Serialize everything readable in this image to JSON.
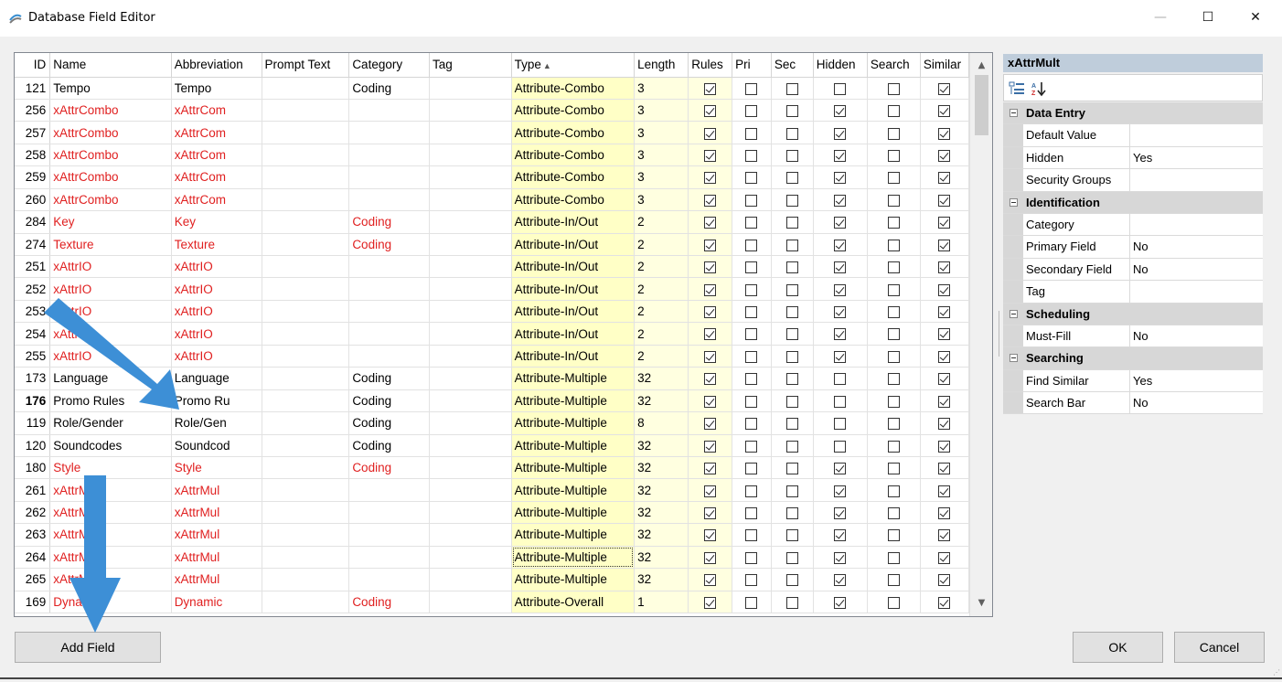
{
  "window": {
    "title": "Database Field Editor",
    "minimize": "—",
    "maximize": "☐",
    "close": "✕"
  },
  "grid": {
    "columns": [
      "ID",
      "Name",
      "Abbreviation",
      "Prompt Text",
      "Category",
      "Tag",
      "Type",
      "Length",
      "Rules",
      "Pri",
      "Sec",
      "Hidden",
      "Search",
      "Similar"
    ],
    "sort_indicator": "▲",
    "rows": [
      {
        "id": "121",
        "name": "Tempo",
        "abbr": "Tempo",
        "prompt": "",
        "category": "Coding",
        "tag": "",
        "type": "Attribute-Combo",
        "length": "3",
        "rules": true,
        "pri": false,
        "sec": false,
        "hidden": false,
        "search": false,
        "similar": true,
        "red": false
      },
      {
        "id": "256",
        "name": "xAttrCombo",
        "abbr": "xAttrCom",
        "prompt": "",
        "category": "",
        "tag": "",
        "type": "Attribute-Combo",
        "length": "3",
        "rules": true,
        "pri": false,
        "sec": false,
        "hidden": true,
        "search": false,
        "similar": true,
        "red": true
      },
      {
        "id": "257",
        "name": "xAttrCombo",
        "abbr": "xAttrCom",
        "prompt": "",
        "category": "",
        "tag": "",
        "type": "Attribute-Combo",
        "length": "3",
        "rules": true,
        "pri": false,
        "sec": false,
        "hidden": true,
        "search": false,
        "similar": true,
        "red": true
      },
      {
        "id": "258",
        "name": "xAttrCombo",
        "abbr": "xAttrCom",
        "prompt": "",
        "category": "",
        "tag": "",
        "type": "Attribute-Combo",
        "length": "3",
        "rules": true,
        "pri": false,
        "sec": false,
        "hidden": true,
        "search": false,
        "similar": true,
        "red": true
      },
      {
        "id": "259",
        "name": "xAttrCombo",
        "abbr": "xAttrCom",
        "prompt": "",
        "category": "",
        "tag": "",
        "type": "Attribute-Combo",
        "length": "3",
        "rules": true,
        "pri": false,
        "sec": false,
        "hidden": true,
        "search": false,
        "similar": true,
        "red": true
      },
      {
        "id": "260",
        "name": "xAttrCombo",
        "abbr": "xAttrCom",
        "prompt": "",
        "category": "",
        "tag": "",
        "type": "Attribute-Combo",
        "length": "3",
        "rules": true,
        "pri": false,
        "sec": false,
        "hidden": true,
        "search": false,
        "similar": true,
        "red": true
      },
      {
        "id": "284",
        "name": "Key",
        "abbr": "Key",
        "prompt": "",
        "category": "Coding",
        "tag": "",
        "type": "Attribute-In/Out",
        "length": "2",
        "rules": true,
        "pri": false,
        "sec": false,
        "hidden": true,
        "search": false,
        "similar": true,
        "red": true
      },
      {
        "id": "274",
        "name": "Texture",
        "abbr": "Texture",
        "prompt": "",
        "category": "Coding",
        "tag": "",
        "type": "Attribute-In/Out",
        "length": "2",
        "rules": true,
        "pri": false,
        "sec": false,
        "hidden": true,
        "search": false,
        "similar": true,
        "red": true
      },
      {
        "id": "251",
        "name": "xAttrIO",
        "abbr": "xAttrIO",
        "prompt": "",
        "category": "",
        "tag": "",
        "type": "Attribute-In/Out",
        "length": "2",
        "rules": true,
        "pri": false,
        "sec": false,
        "hidden": true,
        "search": false,
        "similar": true,
        "red": true
      },
      {
        "id": "252",
        "name": "xAttrIO",
        "abbr": "xAttrIO",
        "prompt": "",
        "category": "",
        "tag": "",
        "type": "Attribute-In/Out",
        "length": "2",
        "rules": true,
        "pri": false,
        "sec": false,
        "hidden": true,
        "search": false,
        "similar": true,
        "red": true
      },
      {
        "id": "253",
        "name": "xAttrIO",
        "abbr": "xAttrIO",
        "prompt": "",
        "category": "",
        "tag": "",
        "type": "Attribute-In/Out",
        "length": "2",
        "rules": true,
        "pri": false,
        "sec": false,
        "hidden": true,
        "search": false,
        "similar": true,
        "red": true
      },
      {
        "id": "254",
        "name": "xAttrIO",
        "abbr": "xAttrIO",
        "prompt": "",
        "category": "",
        "tag": "",
        "type": "Attribute-In/Out",
        "length": "2",
        "rules": true,
        "pri": false,
        "sec": false,
        "hidden": true,
        "search": false,
        "similar": true,
        "red": true
      },
      {
        "id": "255",
        "name": "xAttrIO",
        "abbr": "xAttrIO",
        "prompt": "",
        "category": "",
        "tag": "",
        "type": "Attribute-In/Out",
        "length": "2",
        "rules": true,
        "pri": false,
        "sec": false,
        "hidden": true,
        "search": false,
        "similar": true,
        "red": true
      },
      {
        "id": "173",
        "name": "Language",
        "abbr": "Language",
        "prompt": "",
        "category": "Coding",
        "tag": "",
        "type": "Attribute-Multiple",
        "length": "32",
        "rules": true,
        "pri": false,
        "sec": false,
        "hidden": false,
        "search": false,
        "similar": true,
        "red": false
      },
      {
        "id": "176",
        "name": "Promo Rules",
        "abbr": "Promo Ru",
        "prompt": "",
        "category": "Coding",
        "tag": "",
        "type": "Attribute-Multiple",
        "length": "32",
        "rules": true,
        "pri": false,
        "sec": false,
        "hidden": false,
        "search": false,
        "similar": true,
        "red": false,
        "bold": true
      },
      {
        "id": "119",
        "name": "Role/Gender",
        "abbr": "Role/Gen",
        "prompt": "",
        "category": "Coding",
        "tag": "",
        "type": "Attribute-Multiple",
        "length": "8",
        "rules": true,
        "pri": false,
        "sec": false,
        "hidden": false,
        "search": false,
        "similar": true,
        "red": false
      },
      {
        "id": "120",
        "name": "Soundcodes",
        "abbr": "Soundcod",
        "prompt": "",
        "category": "Coding",
        "tag": "",
        "type": "Attribute-Multiple",
        "length": "32",
        "rules": true,
        "pri": false,
        "sec": false,
        "hidden": false,
        "search": false,
        "similar": true,
        "red": false
      },
      {
        "id": "180",
        "name": "Style",
        "abbr": "Style",
        "prompt": "",
        "category": "Coding",
        "tag": "",
        "type": "Attribute-Multiple",
        "length": "32",
        "rules": true,
        "pri": false,
        "sec": false,
        "hidden": true,
        "search": false,
        "similar": true,
        "red": true
      },
      {
        "id": "261",
        "name": "xAttrMult",
        "abbr": "xAttrMul",
        "prompt": "",
        "category": "",
        "tag": "",
        "type": "Attribute-Multiple",
        "length": "32",
        "rules": true,
        "pri": false,
        "sec": false,
        "hidden": true,
        "search": false,
        "similar": true,
        "red": true
      },
      {
        "id": "262",
        "name": "xAttrMult",
        "abbr": "xAttrMul",
        "prompt": "",
        "category": "",
        "tag": "",
        "type": "Attribute-Multiple",
        "length": "32",
        "rules": true,
        "pri": false,
        "sec": false,
        "hidden": true,
        "search": false,
        "similar": true,
        "red": true
      },
      {
        "id": "263",
        "name": "xAttrMult",
        "abbr": "xAttrMul",
        "prompt": "",
        "category": "",
        "tag": "",
        "type": "Attribute-Multiple",
        "length": "32",
        "rules": true,
        "pri": false,
        "sec": false,
        "hidden": true,
        "search": false,
        "similar": true,
        "red": true
      },
      {
        "id": "264",
        "name": "xAttrMult",
        "abbr": "xAttrMul",
        "prompt": "",
        "category": "",
        "tag": "",
        "type": "Attribute-Multiple",
        "length": "32",
        "rules": true,
        "pri": false,
        "sec": false,
        "hidden": true,
        "search": false,
        "similar": true,
        "red": true,
        "focus": true
      },
      {
        "id": "265",
        "name": "xAttrMult",
        "abbr": "xAttrMul",
        "prompt": "",
        "category": "",
        "tag": "",
        "type": "Attribute-Multiple",
        "length": "32",
        "rules": true,
        "pri": false,
        "sec": false,
        "hidden": true,
        "search": false,
        "similar": true,
        "red": true
      },
      {
        "id": "169",
        "name": "Dynamic",
        "abbr": "Dynamic",
        "prompt": "",
        "category": "Coding",
        "tag": "",
        "type": "Attribute-Overall",
        "length": "1",
        "rules": true,
        "pri": false,
        "sec": false,
        "hidden": true,
        "search": false,
        "similar": true,
        "red": true
      }
    ]
  },
  "properties": {
    "title": "xAttrMult",
    "toolbar": {
      "categorized_icon": "categorized-icon",
      "alphabetical_icon": "sort-az-icon",
      "alphabetical_label": "A↓Z"
    },
    "sections": [
      {
        "name": "Data Entry",
        "rows": [
          {
            "name": "Default Value",
            "value": ""
          },
          {
            "name": "Hidden",
            "value": "Yes"
          },
          {
            "name": "Security Groups",
            "value": ""
          }
        ]
      },
      {
        "name": "Identification",
        "rows": [
          {
            "name": "Category",
            "value": ""
          },
          {
            "name": "Primary Field",
            "value": "No"
          },
          {
            "name": "Secondary Field",
            "value": "No"
          },
          {
            "name": "Tag",
            "value": ""
          }
        ]
      },
      {
        "name": "Scheduling",
        "rows": [
          {
            "name": "Must-Fill",
            "value": "No"
          }
        ]
      },
      {
        "name": "Searching",
        "rows": [
          {
            "name": "Find Similar",
            "value": "Yes"
          },
          {
            "name": "Search Bar",
            "value": "No"
          }
        ]
      }
    ]
  },
  "buttons": {
    "add_field": "Add Field",
    "ok": "OK",
    "cancel": "Cancel"
  },
  "colors": {
    "red_text": "#e02020",
    "type_bg": "#ffffc6",
    "arrow": "#3d8fd6",
    "prop_header": "#bfcddb"
  }
}
